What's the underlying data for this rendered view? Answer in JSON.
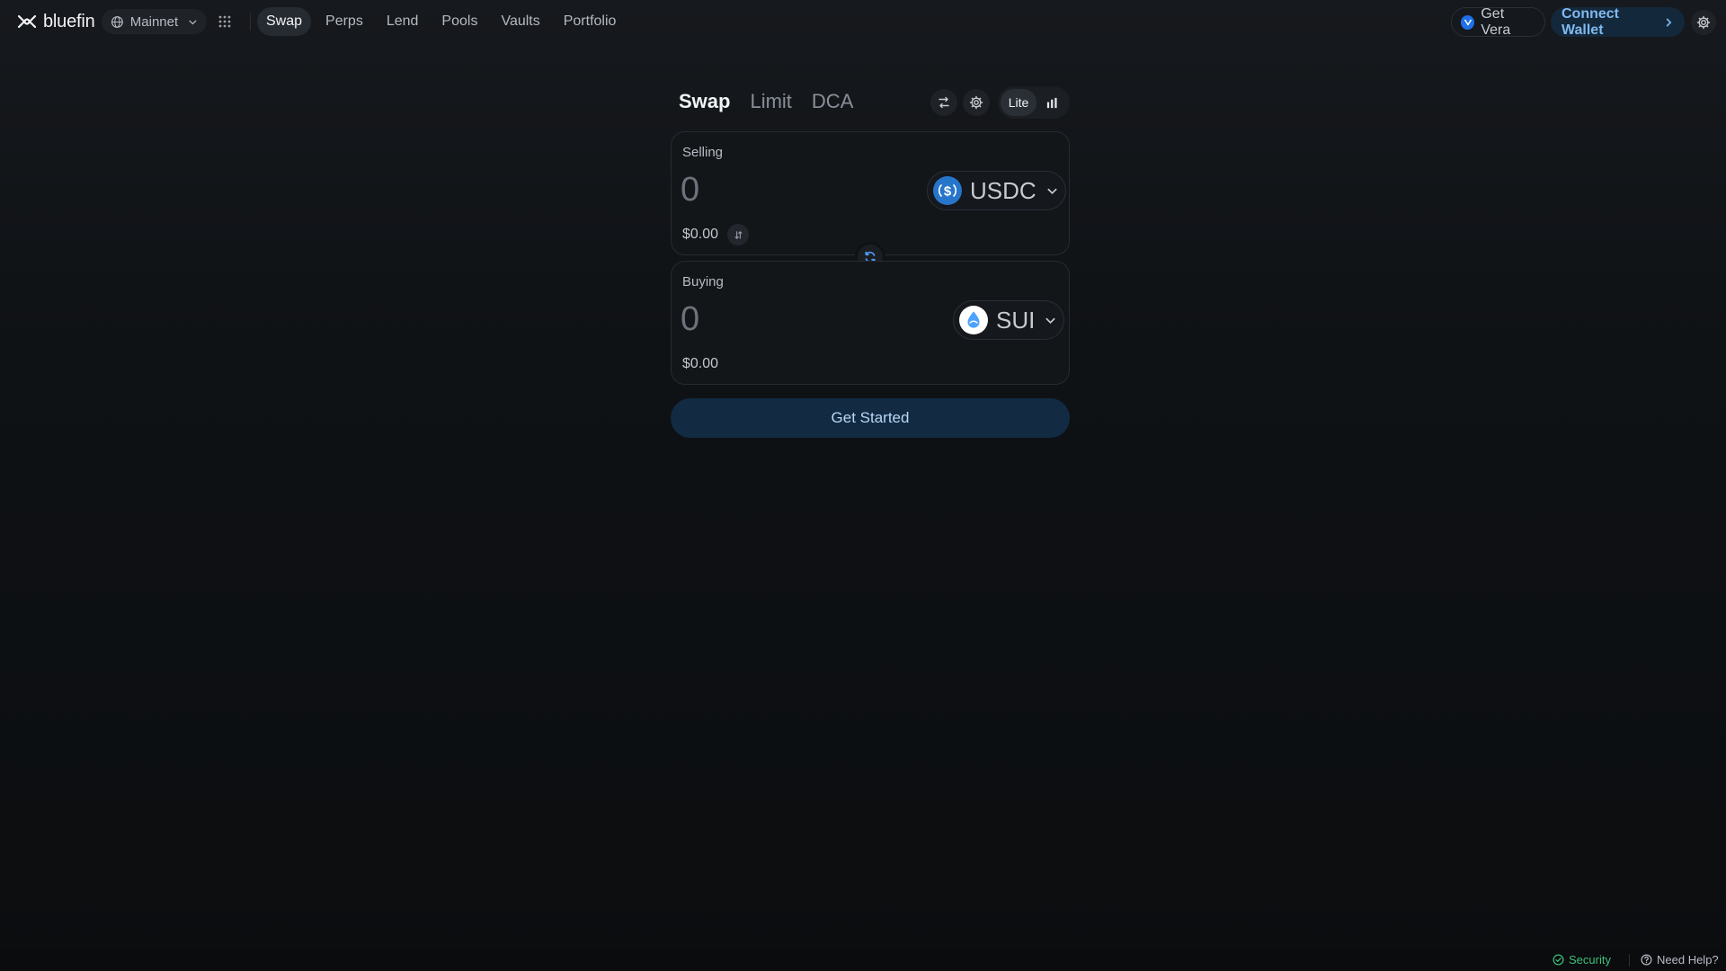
{
  "header": {
    "brand": "bluefin",
    "network": "Mainnet",
    "nav": [
      {
        "label": "Swap",
        "active": true
      },
      {
        "label": "Perps",
        "active": false
      },
      {
        "label": "Lend",
        "active": false
      },
      {
        "label": "Pools",
        "active": false
      },
      {
        "label": "Vaults",
        "active": false
      },
      {
        "label": "Portfolio",
        "active": false
      }
    ],
    "vera_label": "Get Vera",
    "connect_label": "Connect Wallet",
    "icons": [
      "bluefin-logo-icon",
      "globe-icon",
      "chevron-down-icon",
      "apps-grid-icon",
      "vera-icon",
      "chevron-right-icon",
      "gear-icon"
    ]
  },
  "swap": {
    "tabs": [
      {
        "label": "Swap",
        "active": true
      },
      {
        "label": "Limit",
        "active": false
      },
      {
        "label": "DCA",
        "active": false
      }
    ],
    "mode": {
      "lite_label": "Lite",
      "selected": "Lite"
    },
    "tool_icons": [
      "routing-icon",
      "settings-gear-icon",
      "bar-chart-icon"
    ],
    "selling": {
      "label": "Selling",
      "amount_placeholder": "0",
      "token": "USDC",
      "token_icon": "usdc-icon",
      "usd_value": "$0.00"
    },
    "buying": {
      "label": "Buying",
      "amount_placeholder": "0",
      "token": "SUI",
      "token_icon": "sui-icon",
      "usd_value": "$0.00"
    },
    "flip_icon": "swap-direction-icon",
    "cta_label": "Get Started"
  },
  "footer": {
    "security_label": "Security",
    "help_label": "Need Help?"
  },
  "colors": {
    "accent": "#7fb8f0",
    "cta_bg": "#122a42",
    "security_green": "#3fbf7a",
    "usdc_blue": "#2775ca",
    "sui_blue": "#4da2ff"
  }
}
